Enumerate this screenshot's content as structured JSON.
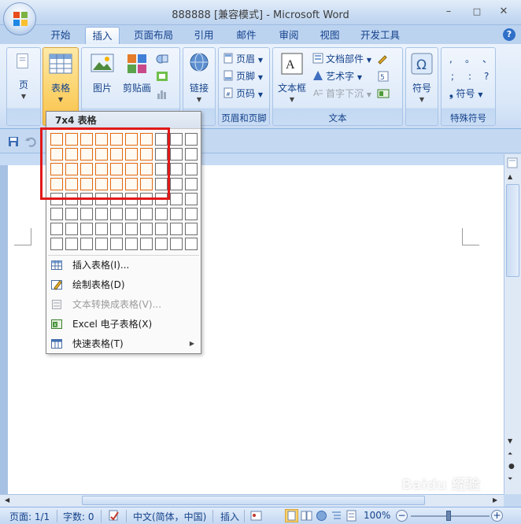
{
  "window": {
    "title": "888888 [兼容模式] - Microsoft Word",
    "minimize": "–",
    "maximize": "□",
    "close": "✕",
    "help": "?"
  },
  "tabs": [
    "开始",
    "插入",
    "页面布局",
    "引用",
    "邮件",
    "审阅",
    "视图",
    "开发工具"
  ],
  "active_tab": "插入",
  "ribbon": {
    "pages_label": "页",
    "table_label": "表格",
    "picture_label": "图片",
    "clipart_label": "剪贴画",
    "link_label": "链接",
    "header_label": "页眉",
    "footer_label": "页脚",
    "page_number_label": "页码",
    "header_footer_group": "页眉和页脚",
    "textbox_label": "文本框",
    "quickparts_label": "文档部件",
    "wordart_label": "艺术字",
    "dropcap_label": "首字下沉",
    "text_group": "文本",
    "symbol_label": "符号",
    "special_symbols": [
      ",",
      "。",
      "、",
      ";",
      ":",
      "?"
    ],
    "special_symbol_btn": "符号",
    "special_group": "特殊符号"
  },
  "dropdown": {
    "title": "7x4 表格",
    "grid_cols": 10,
    "grid_rows": 8,
    "selected_cols": 7,
    "selected_rows": 4,
    "items": [
      {
        "label": "插入表格(I)...",
        "disabled": false,
        "submenu": false
      },
      {
        "label": "绘制表格(D)",
        "disabled": false,
        "submenu": false
      },
      {
        "label": "文本转换成表格(V)...",
        "disabled": true,
        "submenu": false
      },
      {
        "label": "Excel 电子表格(X)",
        "disabled": false,
        "submenu": false
      },
      {
        "label": "快速表格(T)",
        "disabled": false,
        "submenu": true
      }
    ]
  },
  "statusbar": {
    "page": "页面: 1/1",
    "words": "字数: 0",
    "language": "中文(简体，中国)",
    "mode": "插入",
    "zoom": "100%",
    "zoom_out": "−",
    "zoom_in": "+"
  },
  "watermark": "Baidu 经验",
  "colors": {
    "highlight_border": "#e01919",
    "grid_selected": "#e2690f"
  }
}
